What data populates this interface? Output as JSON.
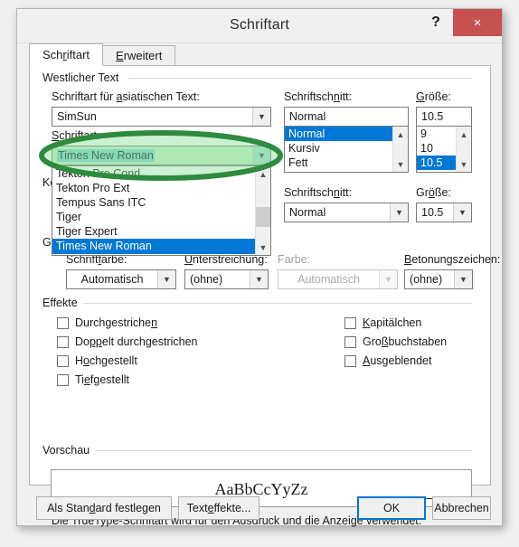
{
  "window": {
    "title": "Schriftart",
    "help_label": "?",
    "close_label": "×"
  },
  "tabs": [
    {
      "label": "Schriftart",
      "accel": "r",
      "active": true
    },
    {
      "label": "Erweitert",
      "accel": "E",
      "active": false
    }
  ],
  "groups": {
    "western": "Westlicher Text",
    "effects": "Effekte",
    "preview": "Vorschau"
  },
  "fields": {
    "asian_font_label": "Schriftart für asiatischen Text:",
    "asian_font_value": "SimSun",
    "font_label": "Schriftart:",
    "font_value": "Times New Roman",
    "style_label": "Schriftschnitt:",
    "style_value": "Normal",
    "size_label": "Größe:",
    "size_value": "10.5",
    "style_label2": "Schriftschnitt:",
    "style_value2": "Normal",
    "size_label2": "Größe:",
    "size_value2": "10.5",
    "color_label": "Schriftfarbe:",
    "color_value": "Automatisch",
    "underline_label": "Unterstreichung:",
    "underline_value": "(ohne)",
    "underline_color_label": "Farbe:",
    "underline_color_value": "Automatisch",
    "emphasis_label": "Betonungszeichen:",
    "emphasis_value": "(ohne)",
    "hidden_label_ko": "Ko",
    "hidden_label_g": "G"
  },
  "font_list": {
    "items": [
      "Tekton Pro Cond",
      "Tekton Pro Ext",
      "Tempus Sans ITC",
      "Tiger",
      "Tiger Expert",
      "Times New Roman"
    ],
    "selected_index": 5
  },
  "style_list": {
    "items": [
      "Normal",
      "Kursiv",
      "Fett"
    ],
    "selected_index": 0
  },
  "size_list": {
    "items": [
      "9",
      "10",
      "10.5"
    ],
    "selected_index": 2
  },
  "effects": {
    "left": [
      {
        "label": "Durchgestrichen",
        "checked": false
      },
      {
        "label": "Doppelt durchgestrichen",
        "checked": false
      },
      {
        "label": "Hochgestellt",
        "checked": false
      },
      {
        "label": "Tiefgestellt",
        "checked": false
      }
    ],
    "right": [
      {
        "label": "Kapitälchen",
        "checked": false
      },
      {
        "label": "Großbuchstaben",
        "checked": false
      },
      {
        "label": "Ausgeblendet",
        "checked": false
      }
    ]
  },
  "preview": {
    "sample_text": "AaBbCcYyZz",
    "note": "Die TrueType-Schriftart wird für den Ausdruck und die Anzeige verwendet."
  },
  "buttons": {
    "set_default": "Als Standard festlegen",
    "text_effects": "Texteffekte...",
    "ok": "OK",
    "cancel": "Abbrechen"
  },
  "annotation": {
    "shape": "ellipse-highlight",
    "stroke_color": "#2d8a3e",
    "fill_color": "#a8e6b0"
  },
  "colors": {
    "selection_blue": "#0078d7",
    "close_red": "#c75050",
    "dialog_bg": "#f0f0f0"
  },
  "icons": {
    "chevron_down": "⌄",
    "scroll_up": "⌃",
    "scroll_down": "⌄"
  }
}
